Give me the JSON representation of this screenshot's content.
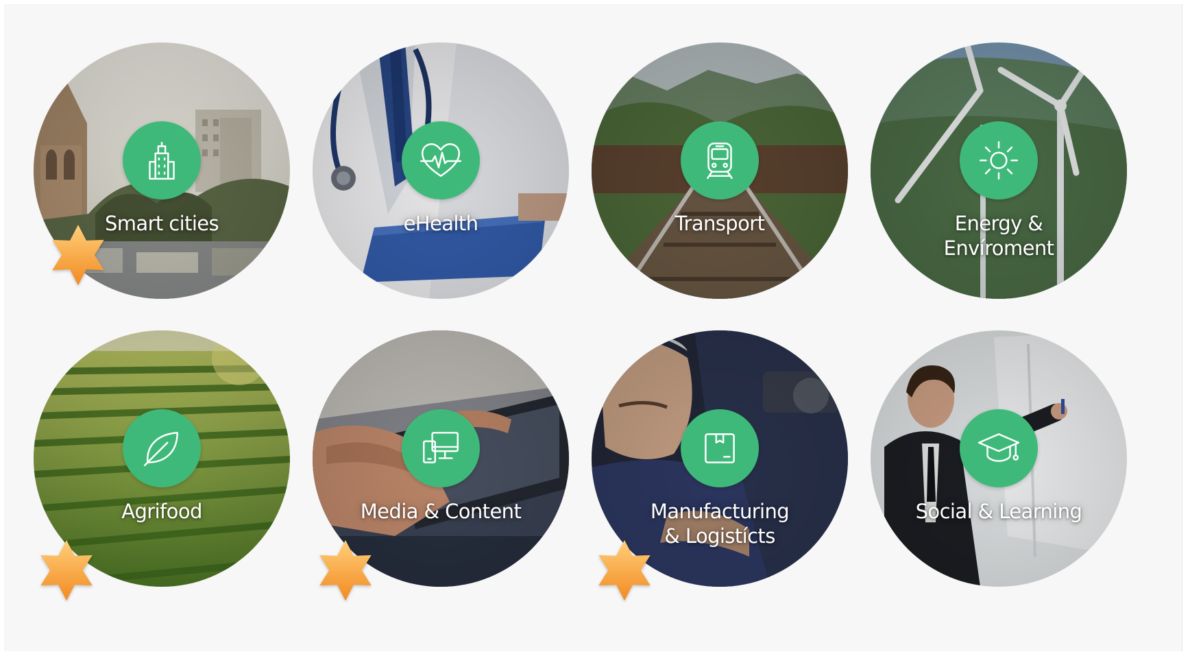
{
  "colors": {
    "badge_green": "#3fb97a",
    "panel_background": "#f7f7f7",
    "star_orange": "#f28a22"
  },
  "tiles": [
    {
      "label_lines": [
        "Smart cities"
      ],
      "icon": "building-icon",
      "starred": true
    },
    {
      "label_lines": [
        "eHealth"
      ],
      "icon": "heart-pulse-icon",
      "starred": false
    },
    {
      "label_lines": [
        "Transport"
      ],
      "icon": "train-icon",
      "starred": false
    },
    {
      "label_lines": [
        "Energy &",
        "Envíroment"
      ],
      "icon": "sun-icon",
      "starred": false
    },
    {
      "label_lines": [
        "Agrifood"
      ],
      "icon": "leaf-icon",
      "starred": true
    },
    {
      "label_lines": [
        "Media & Content"
      ],
      "icon": "devices-icon",
      "starred": true
    },
    {
      "label_lines": [
        "Manufacturing",
        "& Logistícts"
      ],
      "icon": "box-icon",
      "starred": true
    },
    {
      "label_lines": [
        "Social & Learning"
      ],
      "icon": "graduation-cap-icon",
      "starred": false
    }
  ]
}
